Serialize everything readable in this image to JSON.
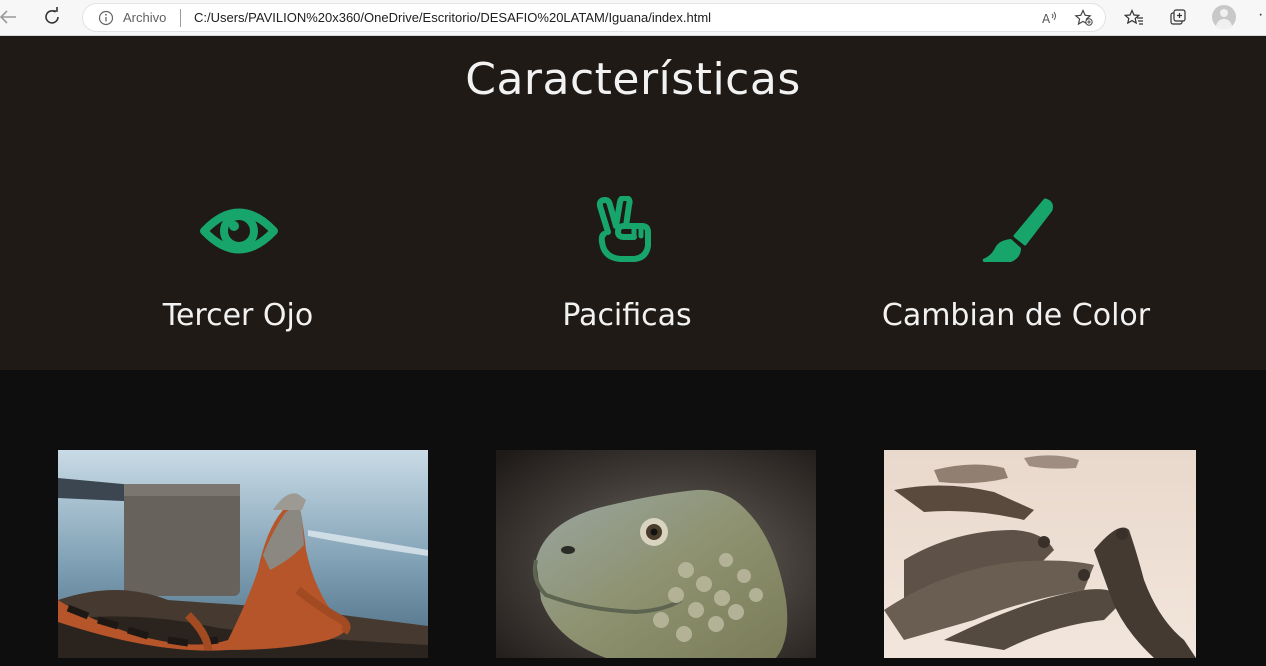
{
  "browser": {
    "archivo_label": "Archivo",
    "url": "C:/Users/PAVILION%20x360/OneDrive/Escritorio/DESAFIO%20LATAM/Iguana/index.html",
    "more_label": "·"
  },
  "features": {
    "title": "Características",
    "items": [
      {
        "label": "Tercer Ojo",
        "icon": "eye-icon"
      },
      {
        "label": "Pacificas",
        "icon": "peace-hand-icon"
      },
      {
        "label": "Cambian de Color",
        "icon": "paintbrush-icon"
      }
    ],
    "accent_color": "#17a56b",
    "background": "#1f1a15"
  },
  "gallery": {
    "photos": [
      {
        "subject": "iguana-on-rocks-by-sea"
      },
      {
        "subject": "iguana-head-closeup"
      },
      {
        "subject": "iguanas-on-sand"
      }
    ]
  }
}
